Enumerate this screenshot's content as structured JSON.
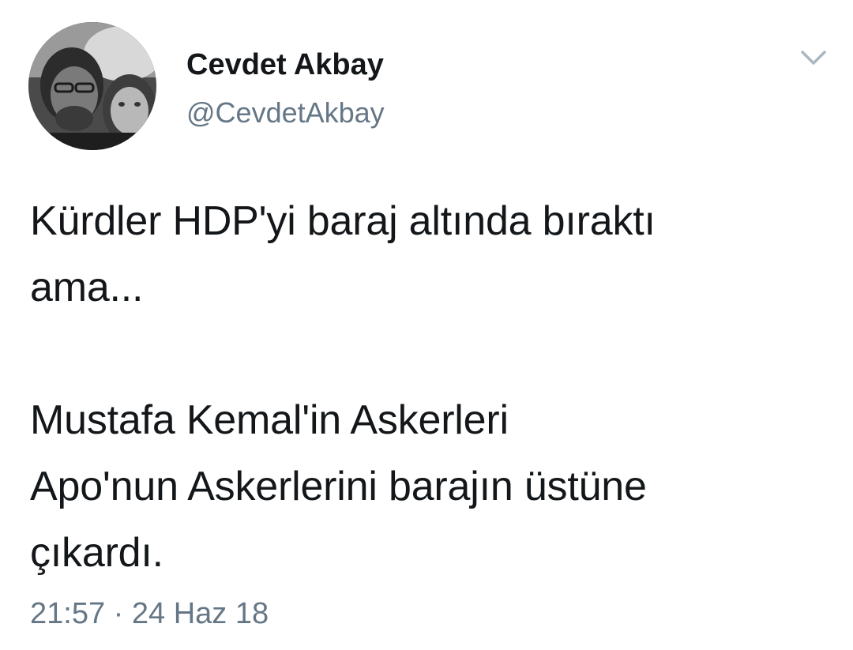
{
  "tweet": {
    "author": {
      "display_name": "Cevdet Akbay",
      "handle": "@CevdetAkbay",
      "avatar_icon": "profile-photo"
    },
    "menu_icon": "chevron-down-icon",
    "text": "Kürdler HDP'yi baraj altında bıraktı\nama...\n\nMustafa Kemal'in Askerleri\nApo'nun Askerlerini barajın üstüne\nçıkardı.",
    "timestamp": "21:57 · 24 Haz 18"
  },
  "colors": {
    "text": "#14171a",
    "secondary": "#657786",
    "chevron": "#aab8c2",
    "background": "#ffffff"
  }
}
